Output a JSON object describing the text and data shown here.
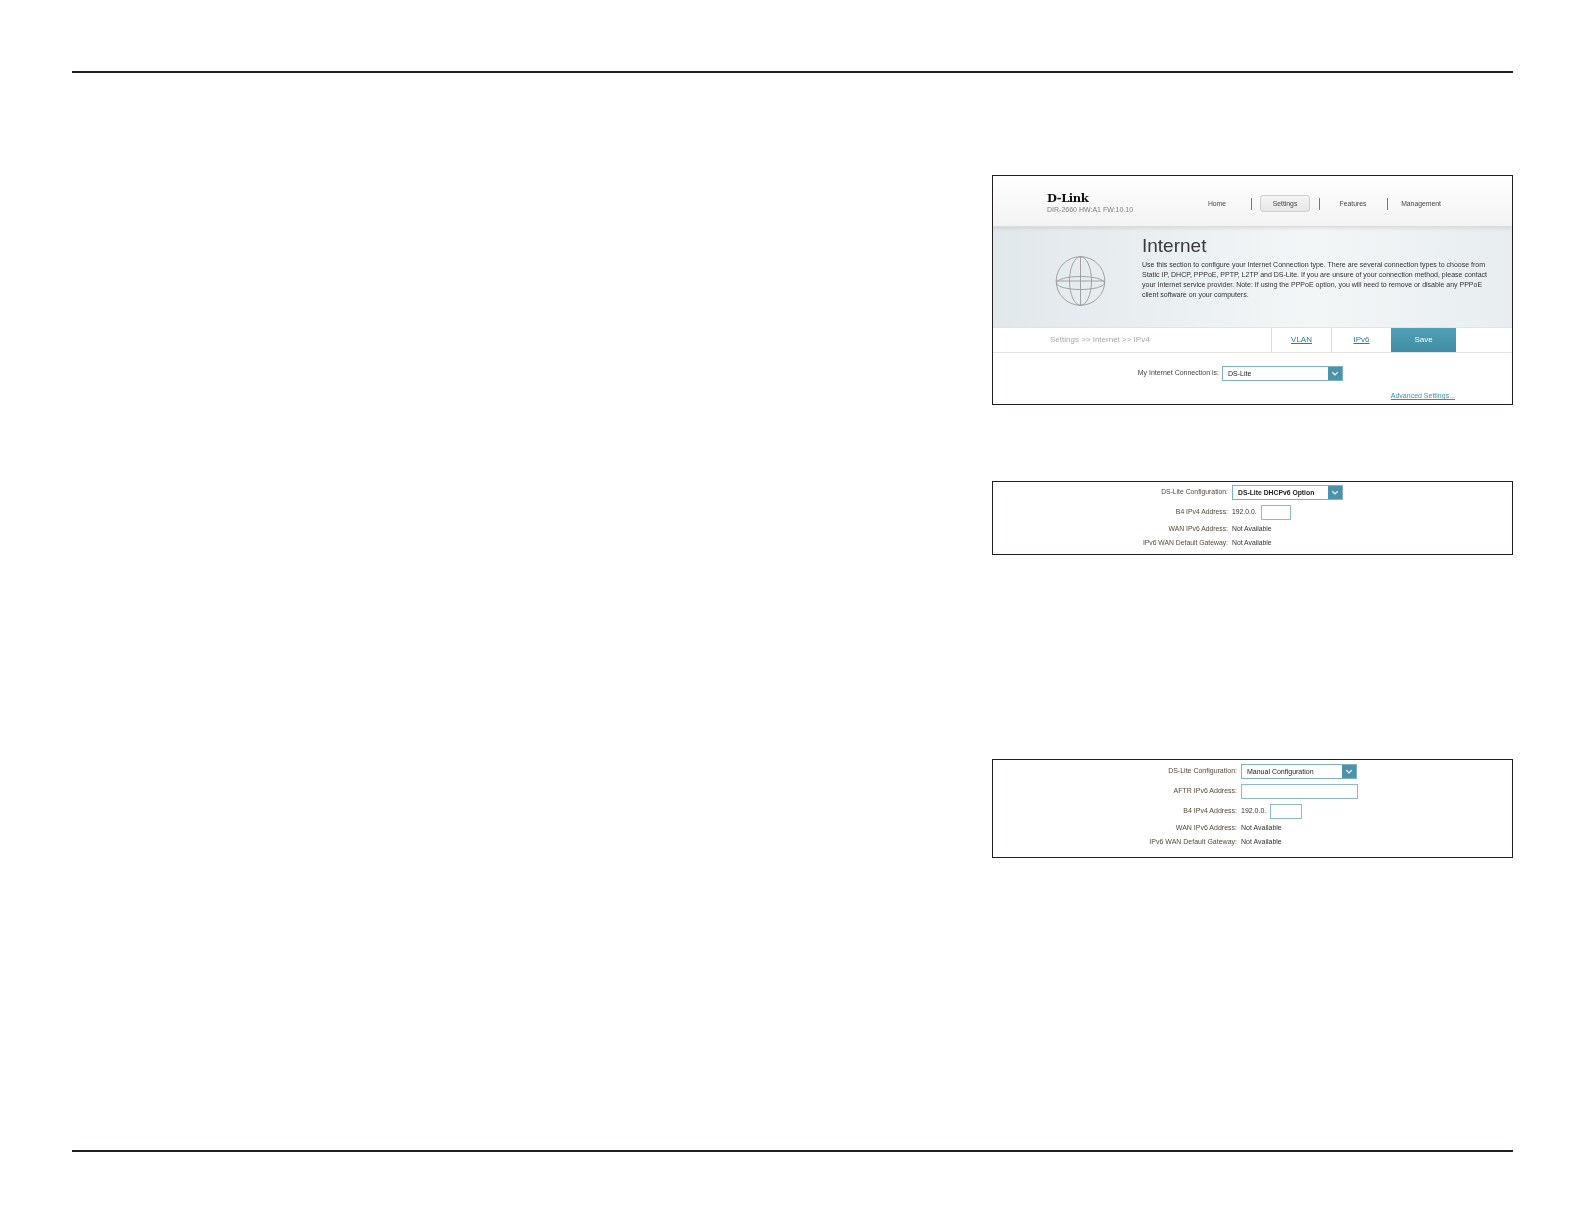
{
  "figures": [
    {
      "kind": "router_page",
      "brand": "D-Link",
      "model": "DIR-2660 HW:A1 FW:10.10",
      "nav": [
        {
          "label": "Home",
          "selected": false
        },
        {
          "label": "Settings",
          "selected": true
        },
        {
          "label": "Features",
          "selected": false
        },
        {
          "label": "Management",
          "selected": false
        }
      ],
      "hero": {
        "title": "Internet",
        "description": "Use this section to configure your Internet Connection type. There are several connection types to choose from Static IP, DHCP, PPPoE, PPTP, L2TP and DS-Lite. If you are unsure of your connection method, please contact your Internet service provider. Note: If using the PPPoE option, you will need to remove or disable any PPPoE client software on your computers."
      },
      "breadcrumb": "Settings >> Internet >> IPv4",
      "actions": [
        {
          "kind": "link",
          "label": "VLAN"
        },
        {
          "kind": "link",
          "label": "IPv6"
        },
        {
          "kind": "button",
          "label": "Save"
        }
      ],
      "fields": [
        {
          "kind": "select",
          "label": "My Internet Connection is:",
          "value": "DS-Lite"
        }
      ],
      "footer_link": "Advanced Settings..."
    },
    {
      "kind": "form_panel",
      "fields": [
        {
          "kind": "select",
          "label": "DS-Lite Configuration:",
          "value": "DS-Lite DHCPv6 Option"
        },
        {
          "kind": "prefixed_input",
          "label": "B4 IPv4 Address:",
          "prefix": "192.0.0."
        },
        {
          "kind": "text",
          "label": "WAN IPv6 Address:",
          "value": "Not Available"
        },
        {
          "kind": "text",
          "label": "IPv6 WAN Default Gateway:",
          "value": "Not Available"
        }
      ]
    },
    {
      "kind": "form_panel",
      "fields": [
        {
          "kind": "select",
          "label": "DS-Lite Configuration:",
          "value": "Manual Configuration"
        },
        {
          "kind": "input",
          "label": "AFTR IPv6 Address:"
        },
        {
          "kind": "prefixed_input",
          "label": "B4 IPv4 Address:",
          "prefix": "192.0.0."
        },
        {
          "kind": "text",
          "label": "WAN IPv6 Address:",
          "value": "Not Available"
        },
        {
          "kind": "text",
          "label": "IPv6 WAN Default Gateway:",
          "value": "Not Available"
        }
      ]
    }
  ]
}
